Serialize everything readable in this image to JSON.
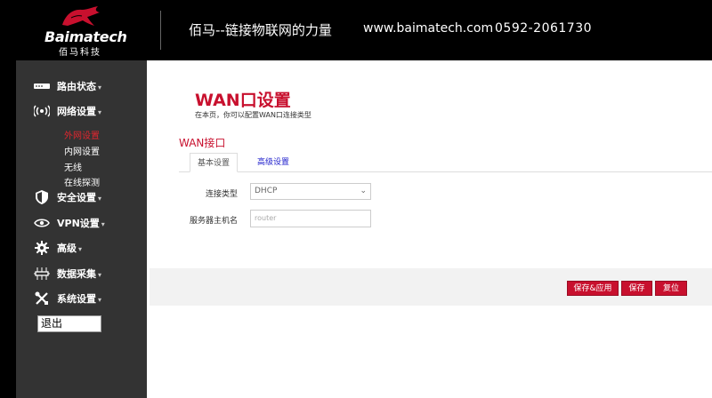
{
  "header": {
    "brand": "Baimatech",
    "brand_cn": "佰马科技",
    "slogan": "佰马--链接物联网的力量",
    "website": "www.baimatech.com",
    "phone": "0592-2061730"
  },
  "sidebar": {
    "items": [
      {
        "label": "路由状态",
        "icon": "router-icon"
      },
      {
        "label": "网络设置",
        "icon": "wireless-signal-icon"
      },
      {
        "label": "安全设置",
        "icon": "shield-icon"
      },
      {
        "label": "VPN设置",
        "icon": "eye-icon"
      },
      {
        "label": "高级",
        "icon": "gear-icon"
      },
      {
        "label": "数据采集",
        "icon": "network-hub-icon"
      },
      {
        "label": "系统设置",
        "icon": "tools-icon"
      }
    ],
    "subitems": [
      "外网设置",
      "内网设置",
      "无线",
      "在线探测"
    ],
    "logout": "退出"
  },
  "main": {
    "title": "WAN口设置",
    "description": "在本页，你可以配置WAN口连接类型",
    "section": "WAN接口",
    "tabs": [
      "基本设置",
      "高级设置"
    ],
    "form": {
      "connection_label": "连接类型",
      "connection_value": "DHCP",
      "hostname_label": "服务器主机名",
      "hostname_placeholder": "router"
    },
    "buttons": {
      "save_apply": "保存&应用",
      "save": "保存",
      "reset": "复位"
    }
  },
  "colors": {
    "accent": "#c8102e",
    "sidebar_bg": "#333333",
    "header_bg": "#000000"
  }
}
